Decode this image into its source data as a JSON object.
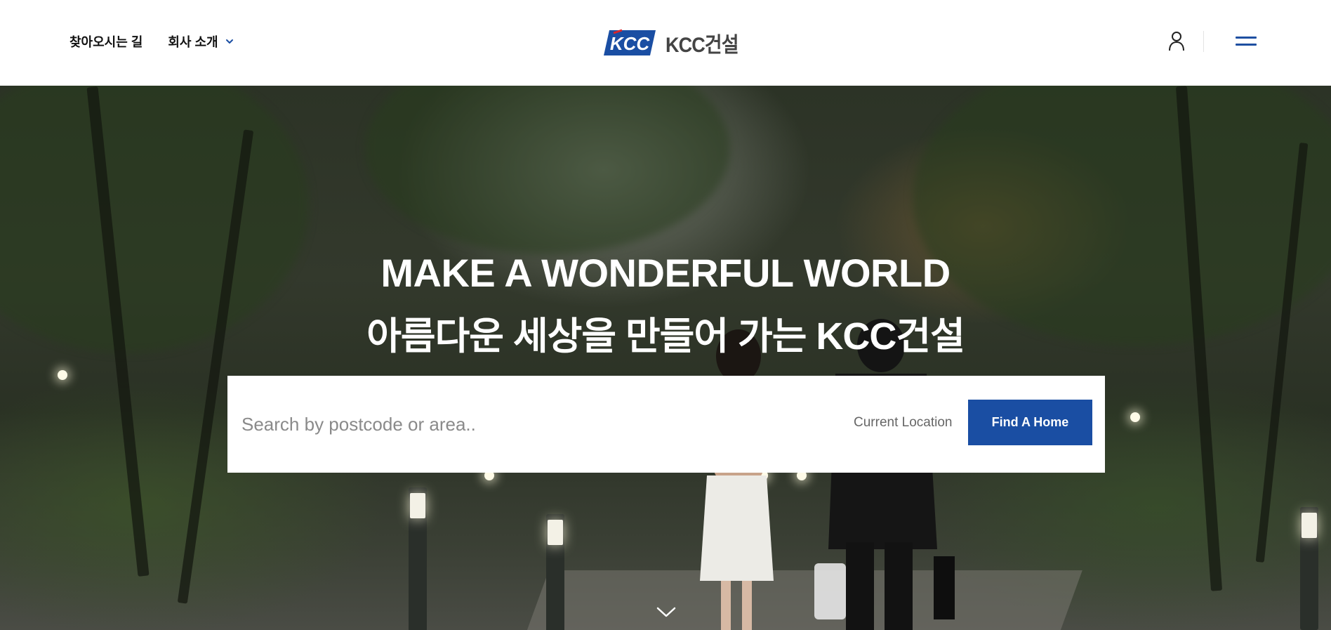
{
  "header": {
    "nav_left": [
      {
        "label": "찾아오시는 길"
      },
      {
        "label": "회사 소개",
        "icon": "chevron-down-icon"
      }
    ],
    "logo_text": "KCC건설",
    "logo_mark_text": "KCC",
    "icons": [
      "user-icon",
      "hamburger-menu-icon"
    ],
    "accent_color": "#1a4ea3"
  },
  "hero": {
    "title": "MAKE A WONDERFUL WORLD",
    "subtitle": "아름다운 세상을 만들어 가는 KCC건설",
    "search": {
      "placeholder": "Search by postcode or area..",
      "value": "",
      "current_location_label": "Current Location",
      "button_label": "Find A Home"
    },
    "scroll_icon": "chevron-down-icon"
  }
}
